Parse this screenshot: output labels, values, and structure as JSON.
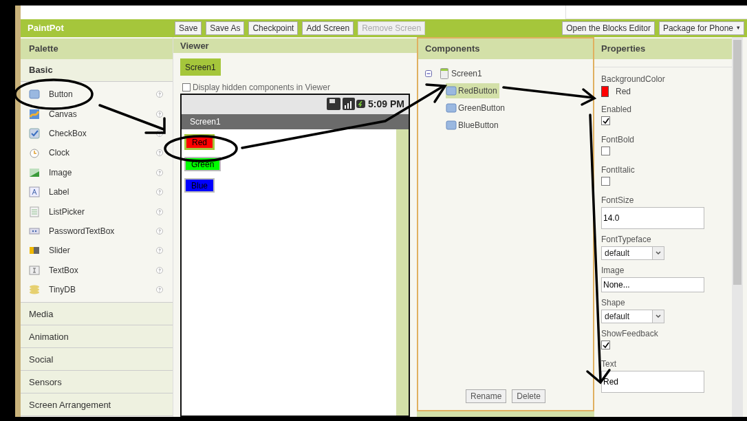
{
  "app": {
    "title": "PaintPot"
  },
  "toolbar": [
    {
      "label": "Save",
      "disabled": false
    },
    {
      "label": "Save As",
      "disabled": false
    },
    {
      "label": "Checkpoint",
      "disabled": false
    },
    {
      "label": "Add Screen",
      "disabled": false
    },
    {
      "label": "Remove Screen",
      "disabled": true
    }
  ],
  "toolbar_right": [
    {
      "label": "Open the Blocks Editor"
    },
    {
      "label": "Package for Phone",
      "caret": "▾"
    }
  ],
  "palette": {
    "header": "Palette",
    "sections": [
      {
        "title": "Basic",
        "expanded": true,
        "items": [
          {
            "label": "Button"
          },
          {
            "label": "Canvas"
          },
          {
            "label": "CheckBox"
          },
          {
            "label": "Clock"
          },
          {
            "label": "Image"
          },
          {
            "label": "Label"
          },
          {
            "label": "ListPicker"
          },
          {
            "label": "PasswordTextBox"
          },
          {
            "label": "Slider"
          },
          {
            "label": "TextBox"
          },
          {
            "label": "TinyDB"
          }
        ]
      },
      {
        "title": "Media",
        "expanded": false
      },
      {
        "title": "Animation",
        "expanded": false
      },
      {
        "title": "Social",
        "expanded": false
      },
      {
        "title": "Sensors",
        "expanded": false
      },
      {
        "title": "Screen Arrangement",
        "expanded": false
      }
    ]
  },
  "viewer": {
    "header": "Viewer",
    "screen_tab": "Screen1",
    "hidden_checkbox": {
      "label": "Display hidden components in Viewer",
      "checked": false
    },
    "phone": {
      "time": "5:09 PM",
      "title": "Screen1",
      "buttons": [
        {
          "label": "Red",
          "color": "#ff0000",
          "selected": true
        },
        {
          "label": "Green",
          "color": "#00ff00",
          "selected": false
        },
        {
          "label": "Blue",
          "color": "#0000ff",
          "selected": false
        }
      ]
    }
  },
  "components": {
    "header": "Components",
    "tree": [
      {
        "label": "Screen1",
        "expanded": true,
        "children": [
          {
            "label": "RedButton",
            "selected": true
          },
          {
            "label": "GreenButton",
            "selected": false
          },
          {
            "label": "BlueButton",
            "selected": false
          }
        ]
      }
    ],
    "buttons": [
      "Rename",
      "Delete"
    ]
  },
  "properties": {
    "header": "Properties",
    "items": [
      {
        "kind": "color",
        "label": "BackgroundColor",
        "value": "Red",
        "color": "#ff0000"
      },
      {
        "kind": "checkbox",
        "label": "Enabled",
        "checked": true
      },
      {
        "kind": "checkbox",
        "label": "FontBold",
        "checked": false
      },
      {
        "kind": "checkbox",
        "label": "FontItalic",
        "checked": false
      },
      {
        "kind": "text",
        "label": "FontSize",
        "value": "14.0"
      },
      {
        "kind": "dropdown",
        "label": "FontTypeface",
        "value": "default"
      },
      {
        "kind": "text",
        "label": "Image",
        "value": "None..."
      },
      {
        "kind": "dropdown",
        "label": "Shape",
        "value": "default"
      },
      {
        "kind": "checkbox",
        "label": "ShowFeedback",
        "checked": true
      },
      {
        "kind": "text",
        "label": "Text",
        "value": "Red"
      }
    ]
  }
}
